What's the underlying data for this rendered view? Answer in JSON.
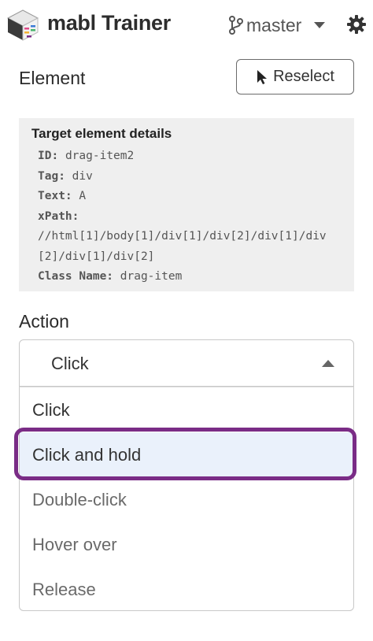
{
  "header": {
    "app_title": "mabl Trainer",
    "branch": "master",
    "icons": {
      "logo": "mabl-logo-icon",
      "branch": "git-branch-icon",
      "caret": "chevron-down-icon",
      "settings": "gear-icon"
    }
  },
  "element_section": {
    "label": "Element",
    "reselect_button": "Reselect"
  },
  "target_details": {
    "title": "Target element details",
    "id_key": "ID:",
    "id_value": "drag-item2",
    "tag_key": "Tag:",
    "tag_value": "div",
    "text_key": "Text:",
    "text_value": "A",
    "xpath_key": "xPath:",
    "xpath_value": "//html[1]/body[1]/div[1]/div[2]/div[1]/div[2]/div[1]/div[2]",
    "class_key": "Class Name:",
    "class_value": "drag-item"
  },
  "action_section": {
    "label": "Action",
    "selected": "Click",
    "options": [
      "Click",
      "Click and hold",
      "Double-click",
      "Hover over",
      "Release"
    ],
    "highlighted_option": "Click and hold",
    "highlight_color": "#7a2c86"
  }
}
